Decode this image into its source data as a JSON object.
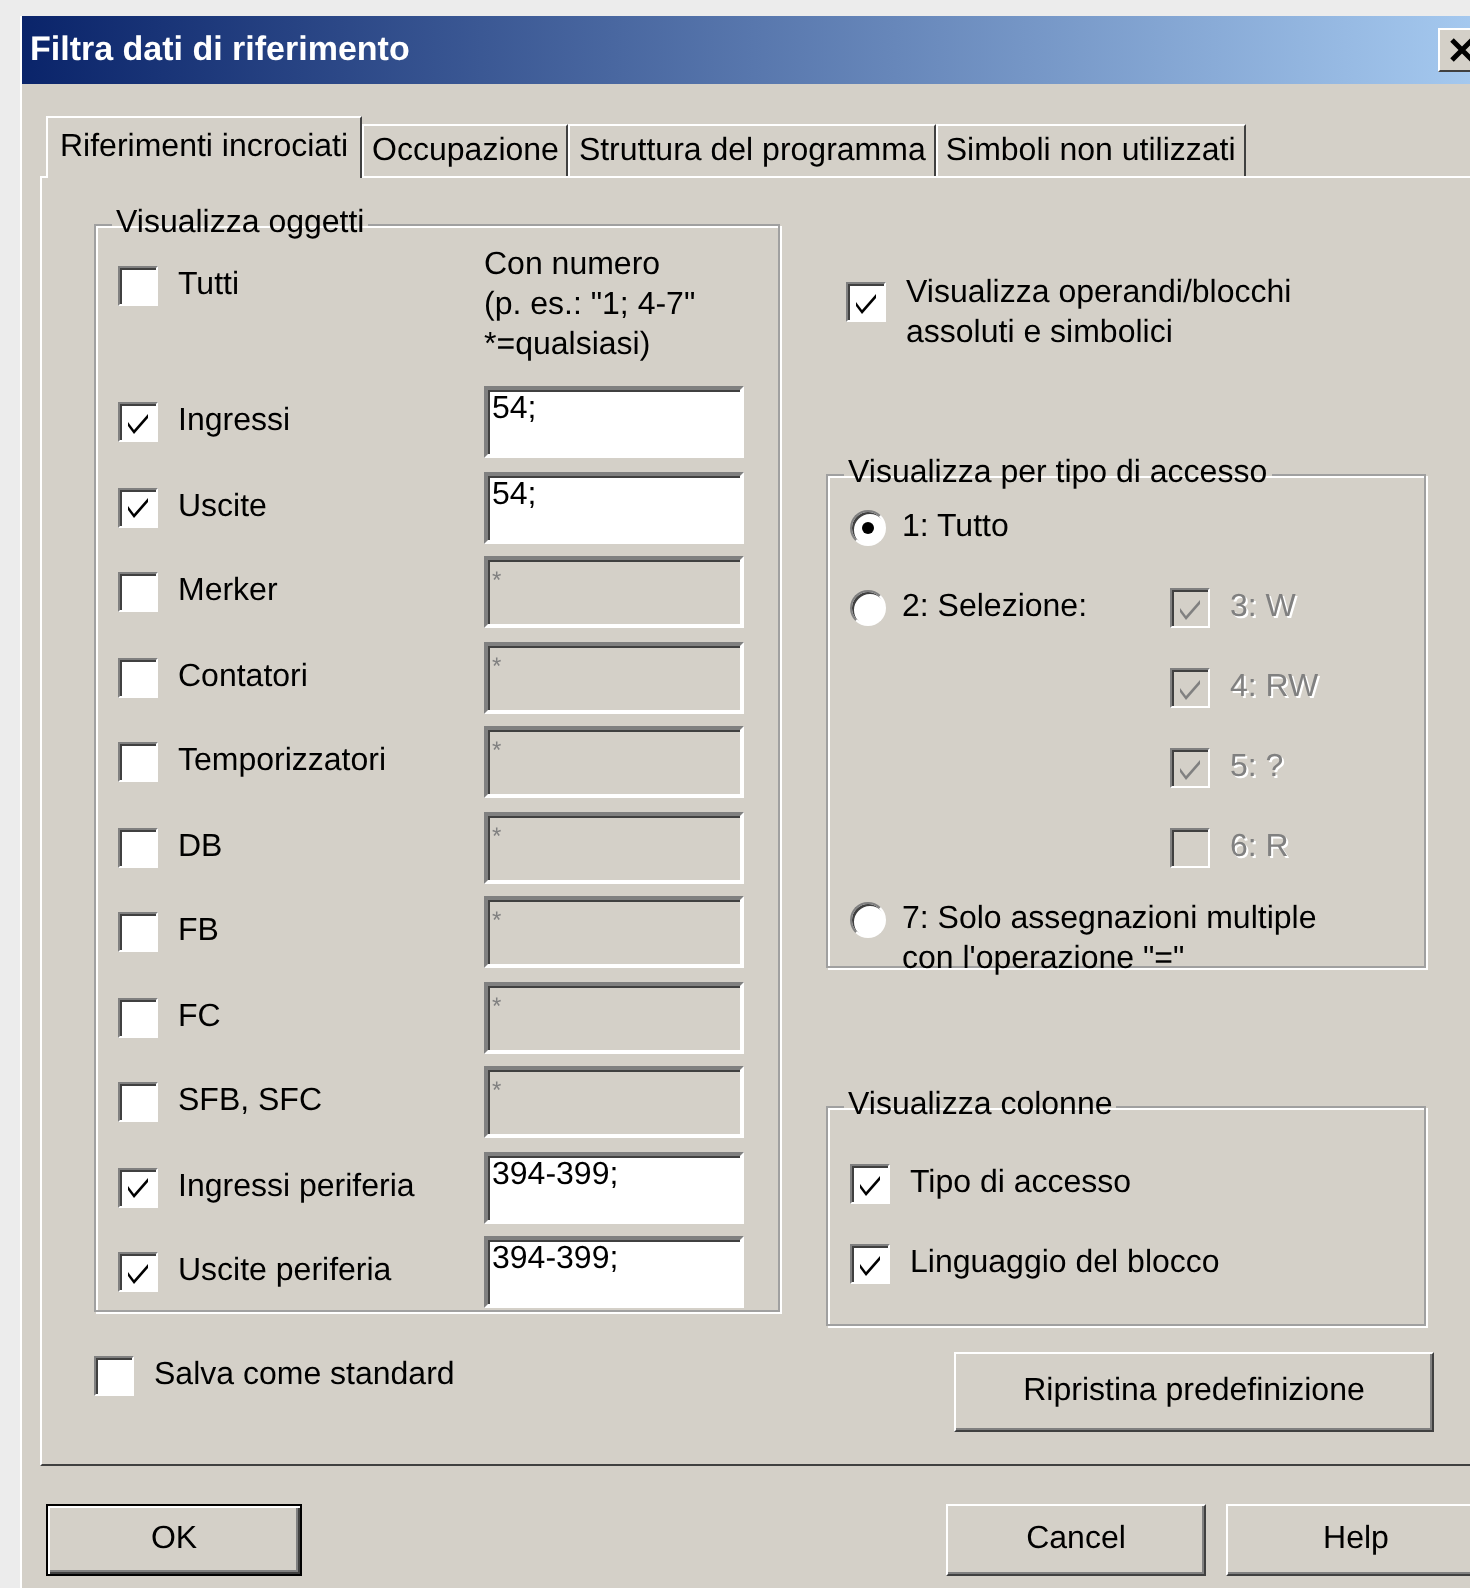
{
  "window": {
    "title": "Filtra dati di riferimento"
  },
  "tabs": [
    {
      "label": "Riferimenti incrociati",
      "selected": true
    },
    {
      "label": "Occupazione",
      "selected": false
    },
    {
      "label": "Struttura del programma",
      "selected": false
    },
    {
      "label": "Simboli non utilizzati",
      "selected": false
    }
  ],
  "objects_group": {
    "title": "Visualizza oggetti",
    "number_header": [
      "Con numero",
      "(p. es.: \"1; 4-7\"",
      "*=qualsiasi)"
    ],
    "items": [
      {
        "label": "Tutti",
        "checked": false
      },
      {
        "label": "Ingressi",
        "checked": true,
        "field": {
          "value": "54;",
          "disabled": false
        }
      },
      {
        "label": "Uscite",
        "checked": true,
        "field": {
          "value": "54;",
          "disabled": false
        }
      },
      {
        "label": "Merker",
        "checked": false,
        "field": {
          "value": "*",
          "disabled": true
        }
      },
      {
        "label": "Contatori",
        "checked": false,
        "field": {
          "value": "*",
          "disabled": true
        }
      },
      {
        "label": "Temporizzatori",
        "checked": false,
        "field": {
          "value": "*",
          "disabled": true
        }
      },
      {
        "label": "DB",
        "checked": false,
        "field": {
          "value": "*",
          "disabled": true
        }
      },
      {
        "label": "FB",
        "checked": false,
        "field": {
          "value": "*",
          "disabled": true
        }
      },
      {
        "label": "FC",
        "checked": false,
        "field": {
          "value": "*",
          "disabled": true
        }
      },
      {
        "label": "SFB, SFC",
        "checked": false,
        "field": {
          "value": "*",
          "disabled": true
        }
      },
      {
        "label": "Ingressi periferia",
        "checked": true,
        "field": {
          "value": "394-399;",
          "disabled": false
        }
      },
      {
        "label": "Uscite periferia",
        "checked": true,
        "field": {
          "value": "394-399;",
          "disabled": false
        }
      }
    ]
  },
  "save_default": {
    "label": "Salva come standard",
    "checked": false
  },
  "show_operands": {
    "label": "Visualizza operandi/blocchi assoluti e simbolici",
    "checked": true
  },
  "access_group": {
    "title": "Visualizza per tipo di accesso",
    "options": [
      {
        "label": "1: Tutto",
        "selected": true
      },
      {
        "label": "2: Selezione:",
        "selected": false,
        "sub_options": [
          {
            "label": "3: W",
            "checked": true,
            "disabled": true
          },
          {
            "label": "4: RW",
            "checked": true,
            "disabled": true
          },
          {
            "label": "5: ?",
            "checked": true,
            "disabled": true
          },
          {
            "label": "6: R",
            "checked": false,
            "disabled": true
          }
        ]
      },
      {
        "label": "7: Solo assegnazioni multiple con l'operazione \"=\"",
        "selected": false
      }
    ]
  },
  "columns_group": {
    "title": "Visualizza colonne",
    "items": [
      {
        "label": "Tipo di accesso",
        "checked": true
      },
      {
        "label": "Linguaggio del blocco",
        "checked": true
      }
    ]
  },
  "reset_button": {
    "label": "Ripristina predefinizione"
  },
  "buttons": [
    {
      "label": "OK",
      "kind": "default"
    },
    {
      "label": "Cancel",
      "kind": "normal"
    },
    {
      "label": "Help",
      "kind": "normal"
    }
  ]
}
